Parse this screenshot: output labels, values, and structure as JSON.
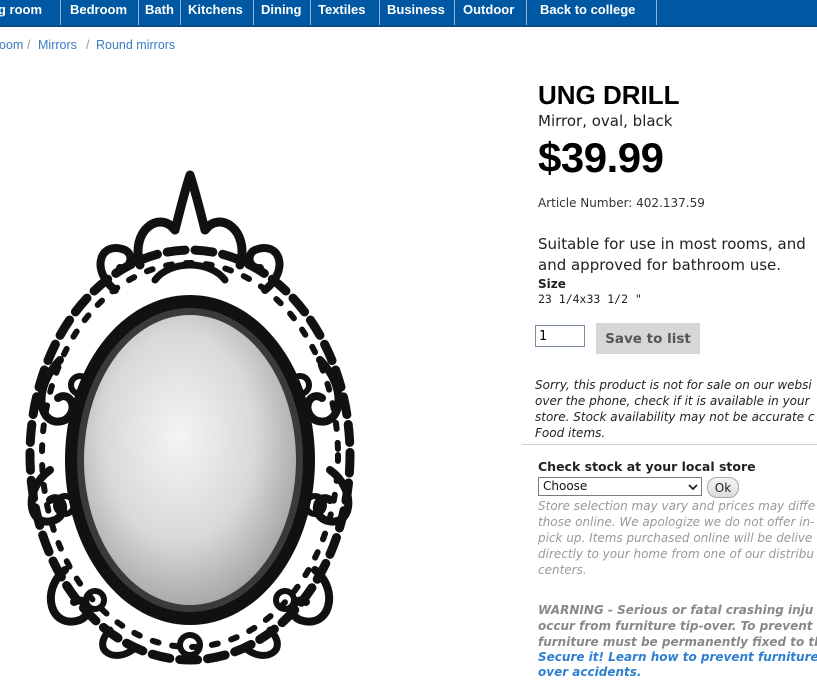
{
  "nav": {
    "items": [
      {
        "label": "g room"
      },
      {
        "label": "Bedroom"
      },
      {
        "label": "Bath"
      },
      {
        "label": "Kitchens"
      },
      {
        "label": "Dining"
      },
      {
        "label": "Textiles"
      },
      {
        "label": "Business"
      },
      {
        "label": "Outdoor"
      },
      {
        "label": "Back to college"
      }
    ],
    "background_color": "#0058a3"
  },
  "breadcrumb": {
    "items": [
      "oom",
      "Mirrors",
      "Round mirrors"
    ],
    "separator": "/"
  },
  "product": {
    "name": "UNG DRILL",
    "description": "Mirror, oval, black",
    "price": "$39.99",
    "article_line": "Article Number: 402.137.59",
    "info_line_1": "Suitable for use in most rooms, and",
    "info_line_2": "and approved for bathroom use.",
    "size_label": "Size",
    "size_value": "23 1/4x33 1/2 \"",
    "image_icon": "ornate-oval-mirror-image"
  },
  "purchase": {
    "quantity_value": "1",
    "save_label": "Save to list"
  },
  "sale_notice": [
    "Sorry, this product is not for sale on our websi",
    "over the phone, check if it is available in your",
    "store. Stock availability may not be accurate c",
    "Food items."
  ],
  "stock": {
    "heading": "Check stock at your local store",
    "select_value": "Choose",
    "ok_label": "Ok",
    "notes": [
      "Store selection may vary and prices may diffe",
      "those online. We apologize we do not offer in-",
      "pick up. Items purchased online will be delive",
      "directly to your home from one of our distribu",
      "centers."
    ]
  },
  "warning": {
    "lines": [
      "WARNING - Serious or fatal crashing inju",
      "occur from furniture tip-over. To prevent",
      "furniture must be permanently fixed to th"
    ],
    "link_lines": [
      "Secure it! Learn how to prevent furniture",
      "over accidents."
    ],
    "link_color": "#2f7fd1"
  }
}
